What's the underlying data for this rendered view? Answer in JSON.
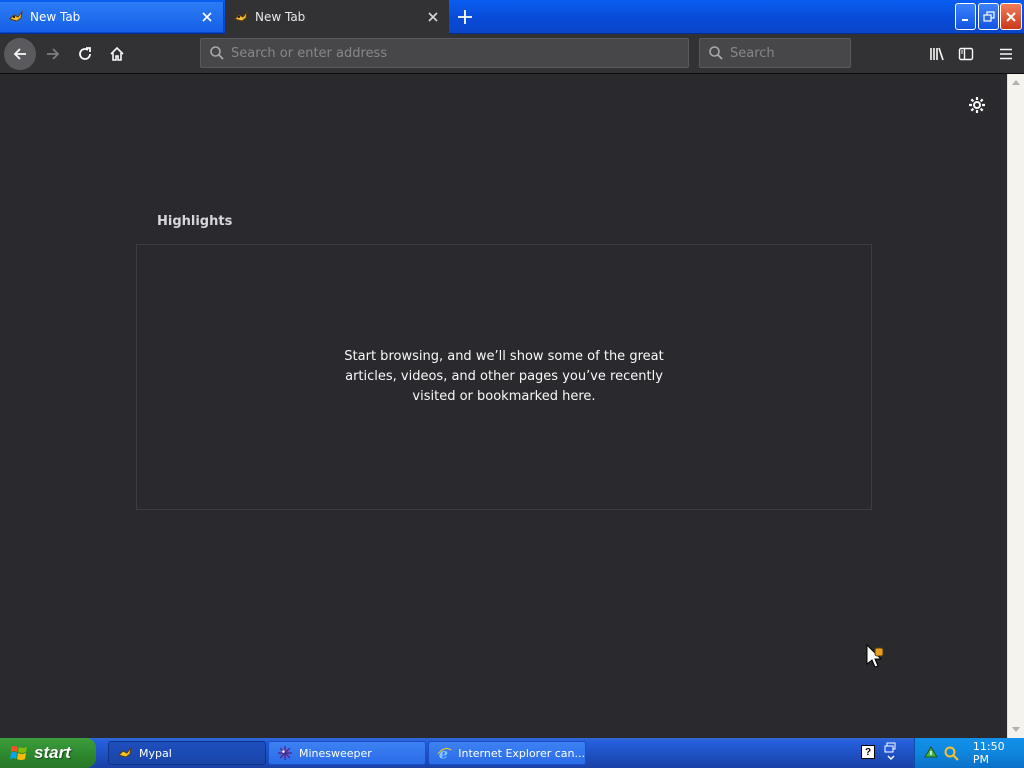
{
  "tabs": [
    {
      "label": "New Tab",
      "active": false
    },
    {
      "label": "New Tab",
      "active": true
    }
  ],
  "toolbar": {
    "address_placeholder": "Search or enter address",
    "search_placeholder": "Search"
  },
  "content": {
    "section_heading": "Highlights",
    "empty_message": "Start browsing, and we’ll show some of the great articles, videos, and other pages you’ve recently visited or bookmarked here."
  },
  "taskbar": {
    "start_label": "start",
    "items": [
      {
        "label": "Mypal",
        "icon": "mypal-icon"
      },
      {
        "label": "Minesweeper",
        "icon": "minesweeper-icon"
      },
      {
        "label": "Internet Explorer can...",
        "icon": "ie-icon"
      }
    ],
    "help_glyph": "?",
    "clock": "11:50 PM"
  },
  "colors": {
    "content_bg": "#2a2a2e",
    "toolbar_bg": "#323234",
    "field_bg": "#474749",
    "xp_blue": "#245edb",
    "start_green": "#3c9e3c",
    "tray_blue": "#0f86dd"
  }
}
